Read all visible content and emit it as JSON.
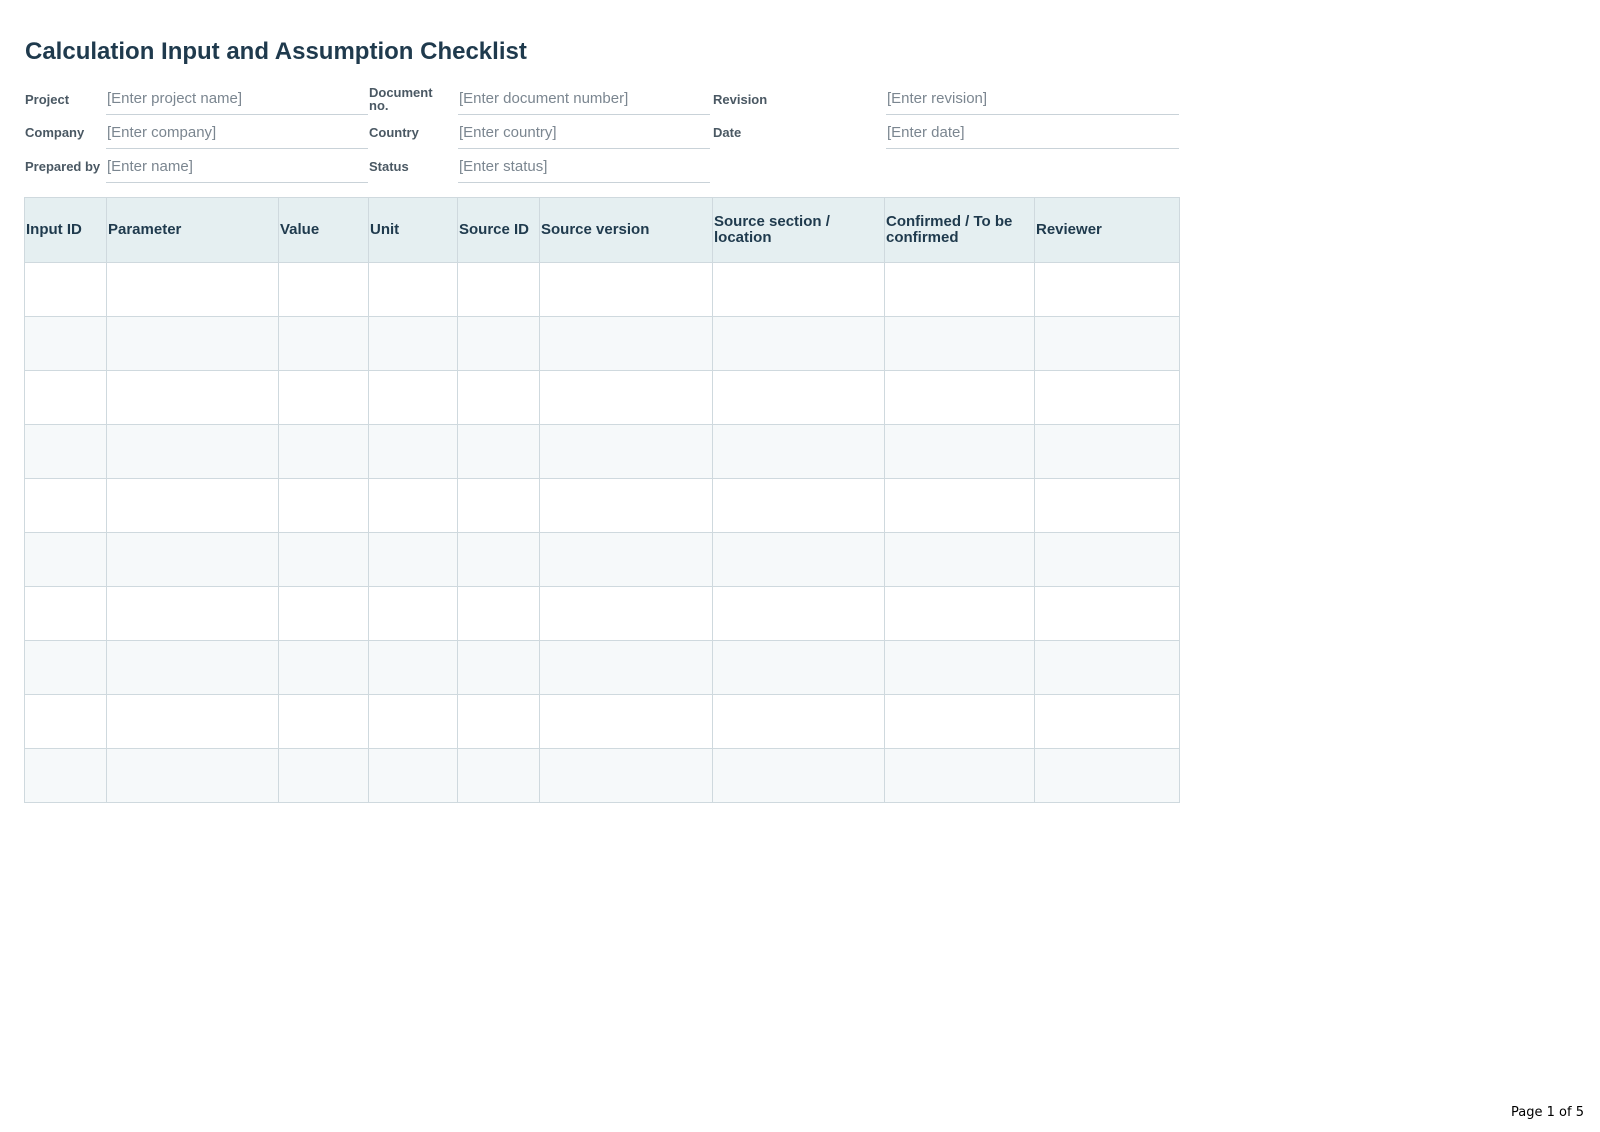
{
  "title": "Calculation Input and Assumption Checklist",
  "meta": {
    "project_label": "Project",
    "project_value": "[Enter project name]",
    "document_no_label": "Document no.",
    "document_no_value": "[Enter document number]",
    "revision_label": "Revision",
    "revision_value": "[Enter revision]",
    "company_label": "Company",
    "company_value": "[Enter company]",
    "country_label": "Country",
    "country_value": "[Enter country]",
    "date_label": "Date",
    "date_value": "[Enter date]",
    "prepared_by_label": "Prepared by",
    "prepared_by_value": "[Enter name]",
    "status_label": "Status",
    "status_value": "[Enter status]"
  },
  "table": {
    "headers": [
      "Input ID",
      "Parameter",
      "Value",
      "Unit",
      "Source ID",
      "Source version",
      "Source section / location",
      "Confirmed / To be confirmed",
      "Reviewer"
    ]
  },
  "footer": {
    "page_label": "Page 1 of 5"
  },
  "colors": {
    "title": "#1f3a4d",
    "header_bg": "#e5eff1",
    "alt_row_bg": "#f6f9fa",
    "border": "#cfd9de"
  }
}
